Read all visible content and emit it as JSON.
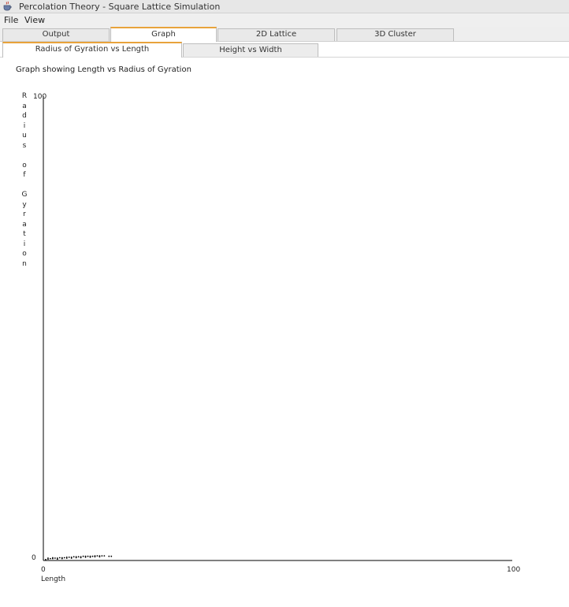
{
  "window": {
    "title": "Percolation Theory - Square Lattice Simulation",
    "icon": "java-cup-icon"
  },
  "menubar": {
    "items": [
      "File",
      "View"
    ]
  },
  "tabs": [
    {
      "label": "Output",
      "active": false
    },
    {
      "label": "Graph",
      "active": true
    },
    {
      "label": "2D Lattice",
      "active": false
    },
    {
      "label": "3D Cluster",
      "active": false
    }
  ],
  "subtabs": [
    {
      "label": "Radius of Gyration vs Length",
      "active": true
    },
    {
      "label": "Height vs Width",
      "active": false
    }
  ],
  "graph": {
    "heading": "Graph showing Length vs Radius of Gyration",
    "ylabel_chars": [
      "R",
      "a",
      "d",
      "i",
      "u",
      "s",
      "",
      "o",
      "f",
      "",
      "G",
      "y",
      "r",
      "a",
      "t",
      "i",
      "o",
      "n"
    ]
  },
  "chart_data": {
    "type": "scatter",
    "title": "Graph showing Length vs Radius of Gyration",
    "xlabel": "Length",
    "ylabel": "Radius of Gyration",
    "xlim": [
      0,
      100
    ],
    "ylim": [
      0,
      100
    ],
    "x_ticks": [
      "0",
      "100"
    ],
    "y_ticks": [
      "0",
      "100"
    ],
    "grid": false,
    "series": [
      {
        "color": "#000000",
        "points": [
          [
            0.5,
            0.2
          ],
          [
            1,
            0.3
          ],
          [
            1.5,
            0.4
          ],
          [
            2,
            0.4
          ],
          [
            2.5,
            0.5
          ],
          [
            3,
            0.5
          ],
          [
            3.5,
            0.6
          ],
          [
            4,
            0.6
          ],
          [
            4.5,
            0.6
          ],
          [
            5,
            0.7
          ],
          [
            5.5,
            0.7
          ],
          [
            6,
            0.7
          ],
          [
            6.5,
            0.8
          ],
          [
            7,
            0.8
          ],
          [
            7.5,
            0.8
          ],
          [
            8,
            0.8
          ],
          [
            8.5,
            0.9
          ],
          [
            9,
            0.9
          ],
          [
            9.5,
            0.9
          ],
          [
            10,
            0.9
          ],
          [
            10.5,
            0.9
          ],
          [
            11,
            1.0
          ],
          [
            11.5,
            1.0
          ],
          [
            12,
            1.0
          ],
          [
            12.5,
            1.0
          ],
          [
            13,
            1.0
          ],
          [
            14,
            0.9
          ],
          [
            14.5,
            0.9
          ],
          [
            1,
            0.5
          ],
          [
            2,
            0.6
          ],
          [
            3,
            0.3
          ],
          [
            4,
            0.4
          ],
          [
            5,
            0.5
          ],
          [
            6,
            0.5
          ],
          [
            7,
            0.6
          ],
          [
            8,
            0.6
          ],
          [
            9,
            0.7
          ],
          [
            10,
            0.7
          ],
          [
            11,
            0.8
          ],
          [
            12,
            0.8
          ]
        ]
      }
    ]
  }
}
